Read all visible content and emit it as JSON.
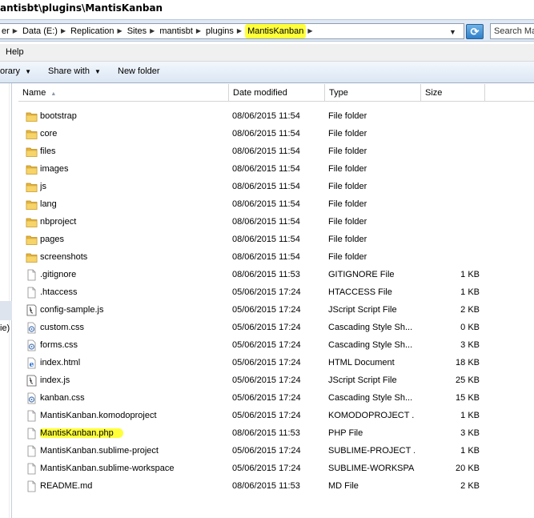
{
  "window": {
    "title": "antisbt\\plugins\\MantisKanban"
  },
  "address": {
    "crumbs": [
      {
        "label": "er",
        "highlight": false
      },
      {
        "label": "Data (E:)",
        "highlight": false
      },
      {
        "label": "Replication",
        "highlight": false
      },
      {
        "label": "Sites",
        "highlight": false
      },
      {
        "label": "mantisbt",
        "highlight": false
      },
      {
        "label": "plugins",
        "highlight": false
      },
      {
        "label": "MantisKanban",
        "highlight": true
      }
    ],
    "search_placeholder": "Search Ma",
    "highlight_color": "#ffff3a"
  },
  "menu": {
    "help": "Help"
  },
  "toolbar": {
    "library": "orary",
    "share": "Share with",
    "new_folder": "New folder"
  },
  "navpane": {
    "cut_label": "ie)"
  },
  "columns": {
    "name": "Name",
    "date": "Date modified",
    "type": "Type",
    "size": "Size"
  },
  "files": [
    {
      "name": "bootstrap",
      "date": "08/06/2015 11:54",
      "type": "File folder",
      "size": "",
      "icon": "folder-icon"
    },
    {
      "name": "core",
      "date": "08/06/2015 11:54",
      "type": "File folder",
      "size": "",
      "icon": "folder-icon"
    },
    {
      "name": "files",
      "date": "08/06/2015 11:54",
      "type": "File folder",
      "size": "",
      "icon": "folder-icon"
    },
    {
      "name": "images",
      "date": "08/06/2015 11:54",
      "type": "File folder",
      "size": "",
      "icon": "folder-icon"
    },
    {
      "name": "js",
      "date": "08/06/2015 11:54",
      "type": "File folder",
      "size": "",
      "icon": "folder-icon"
    },
    {
      "name": "lang",
      "date": "08/06/2015 11:54",
      "type": "File folder",
      "size": "",
      "icon": "folder-icon"
    },
    {
      "name": "nbproject",
      "date": "08/06/2015 11:54",
      "type": "File folder",
      "size": "",
      "icon": "folder-icon"
    },
    {
      "name": "pages",
      "date": "08/06/2015 11:54",
      "type": "File folder",
      "size": "",
      "icon": "folder-icon"
    },
    {
      "name": "screenshots",
      "date": "08/06/2015 11:54",
      "type": "File folder",
      "size": "",
      "icon": "folder-icon"
    },
    {
      "name": ".gitignore",
      "date": "08/06/2015 11:53",
      "type": "GITIGNORE File",
      "size": "1 KB",
      "icon": "file-icon"
    },
    {
      "name": ".htaccess",
      "date": "05/06/2015 17:24",
      "type": "HTACCESS File",
      "size": "1 KB",
      "icon": "file-icon"
    },
    {
      "name": "config-sample.js",
      "date": "05/06/2015 17:24",
      "type": "JScript Script File",
      "size": "2 KB",
      "icon": "script-icon"
    },
    {
      "name": "custom.css",
      "date": "05/06/2015 17:24",
      "type": "Cascading Style Sh...",
      "size": "0 KB",
      "icon": "css-icon"
    },
    {
      "name": "forms.css",
      "date": "05/06/2015 17:24",
      "type": "Cascading Style Sh...",
      "size": "3 KB",
      "icon": "css-icon"
    },
    {
      "name": "index.html",
      "date": "05/06/2015 17:24",
      "type": "HTML Document",
      "size": "18 KB",
      "icon": "html-icon"
    },
    {
      "name": "index.js",
      "date": "05/06/2015 17:24",
      "type": "JScript Script File",
      "size": "25 KB",
      "icon": "script-icon"
    },
    {
      "name": "kanban.css",
      "date": "05/06/2015 17:24",
      "type": "Cascading Style Sh...",
      "size": "15 KB",
      "icon": "css-icon"
    },
    {
      "name": "MantisKanban.komodoproject",
      "date": "05/06/2015 17:24",
      "type": "KOMODOPROJECT ...",
      "size": "1 KB",
      "icon": "file-icon"
    },
    {
      "name": "MantisKanban.php",
      "date": "08/06/2015 11:53",
      "type": "PHP File",
      "size": "3 KB",
      "icon": "file-icon",
      "highlight": true
    },
    {
      "name": "MantisKanban.sublime-project",
      "date": "05/06/2015 17:24",
      "type": "SUBLIME-PROJECT ...",
      "size": "1 KB",
      "icon": "file-icon"
    },
    {
      "name": "MantisKanban.sublime-workspace",
      "date": "05/06/2015 17:24",
      "type": "SUBLIME-WORKSPA...",
      "size": "20 KB",
      "icon": "file-icon"
    },
    {
      "name": "README.md",
      "date": "08/06/2015 11:53",
      "type": "MD File",
      "size": "2 KB",
      "icon": "file-icon"
    }
  ]
}
